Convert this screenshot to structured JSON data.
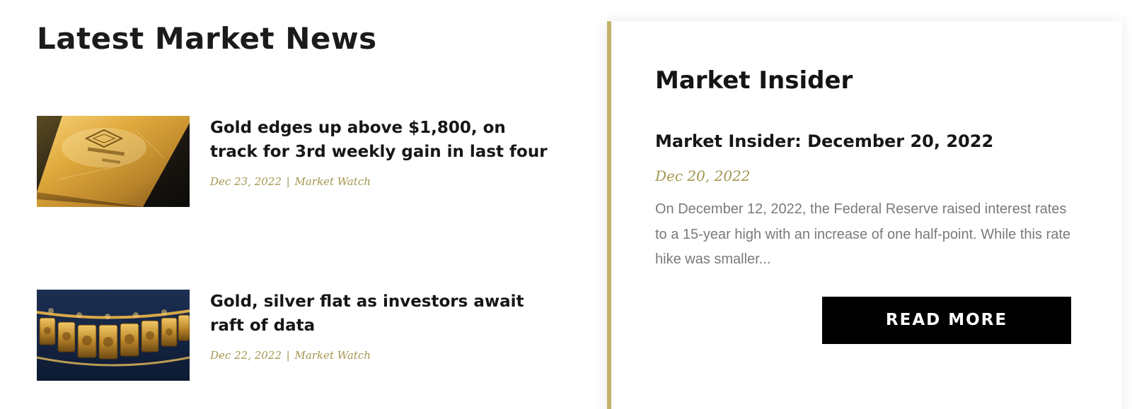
{
  "news": {
    "title": "Latest Market News",
    "items": [
      {
        "headline": "Gold edges up above $1,800, on track for 3rd weekly gain in last four",
        "date": "Dec 23, 2022",
        "separator": "|",
        "source": "Market Watch",
        "image_icon": "gold-bar-image"
      },
      {
        "headline": "Gold, silver flat as investors await raft of data",
        "date": "Dec 22, 2022",
        "separator": "|",
        "source": "Market Watch",
        "image_icon": "gold-necklace-image"
      }
    ]
  },
  "insider": {
    "title": "Market Insider",
    "post_title": "Market Insider: December 20, 2022",
    "date": "Dec 20, 2022",
    "excerpt": "On December 12, 2022, the Federal Reserve raised interest rates to a 15-year high with an increase of one half-point. While this rate hike was smaller...",
    "button_label": "READ MORE"
  },
  "colors": {
    "accent_gold": "#a4964f",
    "card_border": "#c2b26d",
    "button_bg": "#000000",
    "text_dark": "#161616",
    "text_muted": "#7a7a7a"
  }
}
